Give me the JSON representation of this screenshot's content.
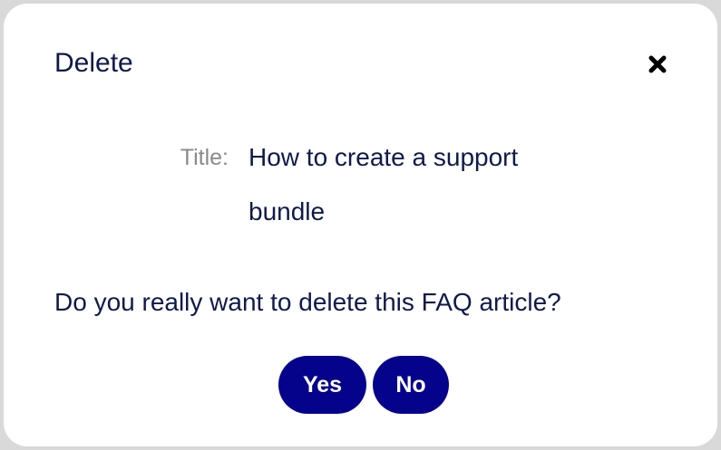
{
  "dialog": {
    "title": "Delete",
    "close_icon": "close-icon",
    "field": {
      "label": "Title:",
      "value": "How to create a support bundle"
    },
    "question": "Do you really want to delete this FAQ article?",
    "buttons": {
      "yes_label": "Yes",
      "no_label": "No"
    }
  },
  "colors": {
    "primary": "#05038c",
    "text": "#0f1a4a",
    "label": "#8a8a8a",
    "background": "#ffffff"
  }
}
